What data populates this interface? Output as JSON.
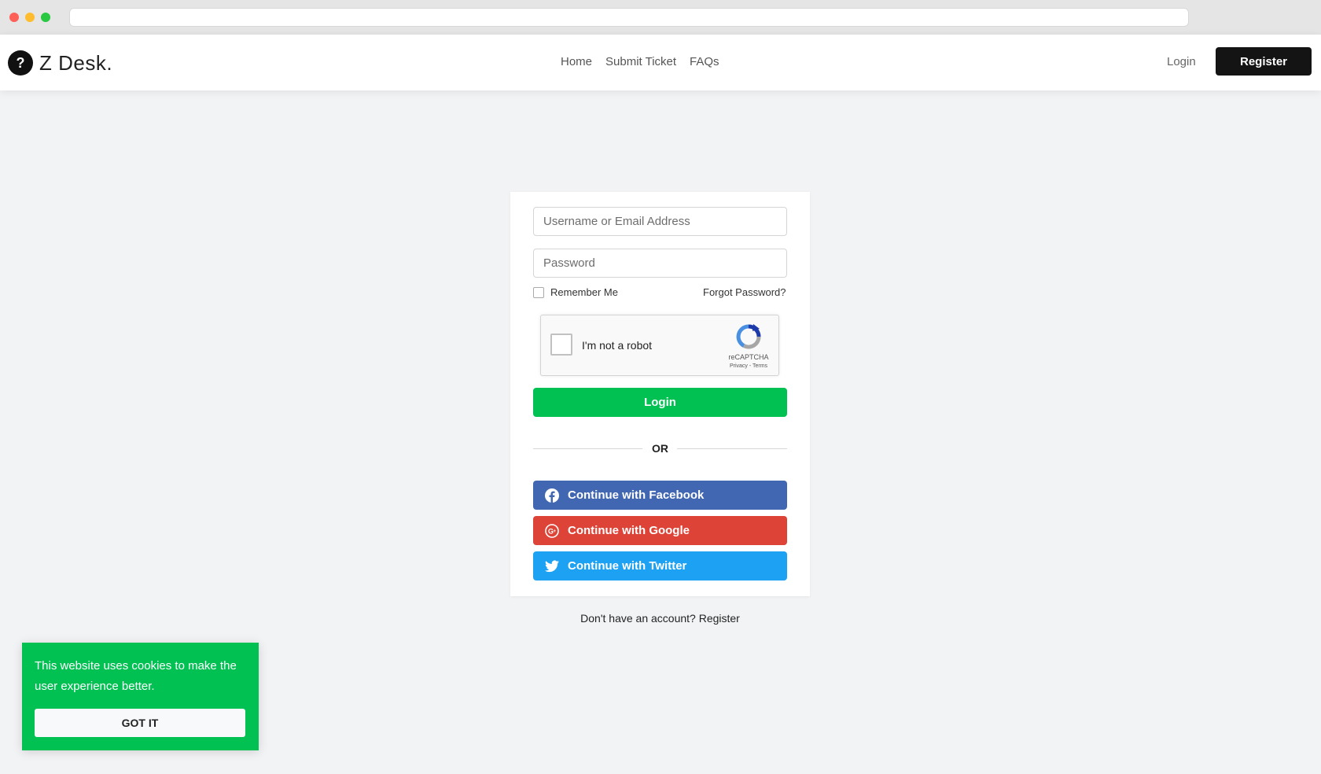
{
  "brand": {
    "logo_symbol": "?",
    "name": "Z Desk."
  },
  "nav": {
    "links": [
      "Home",
      "Submit Ticket",
      "FAQs"
    ],
    "login": "Login",
    "register": "Register"
  },
  "form": {
    "username_placeholder": "Username or Email Address",
    "password_placeholder": "Password",
    "remember_label": "Remember Me",
    "forgot_label": "Forgot Password?",
    "captcha": {
      "label": "I'm not a robot",
      "brand": "reCAPTCHA",
      "terms": "Privacy - Terms"
    },
    "login_button": "Login",
    "divider": "OR",
    "social": {
      "facebook": "Continue with Facebook",
      "google": "Continue with Google",
      "twitter": "Continue with Twitter"
    }
  },
  "register_prompt": "Don't have an account? Register",
  "cookie": {
    "message": "This website uses cookies to make the user experience better.",
    "button": "GOT IT"
  },
  "colors": {
    "primary_green": "#01c153",
    "facebook": "#4267b2",
    "google": "#dd4336",
    "twitter": "#1da1f2",
    "dark": "#141414"
  }
}
